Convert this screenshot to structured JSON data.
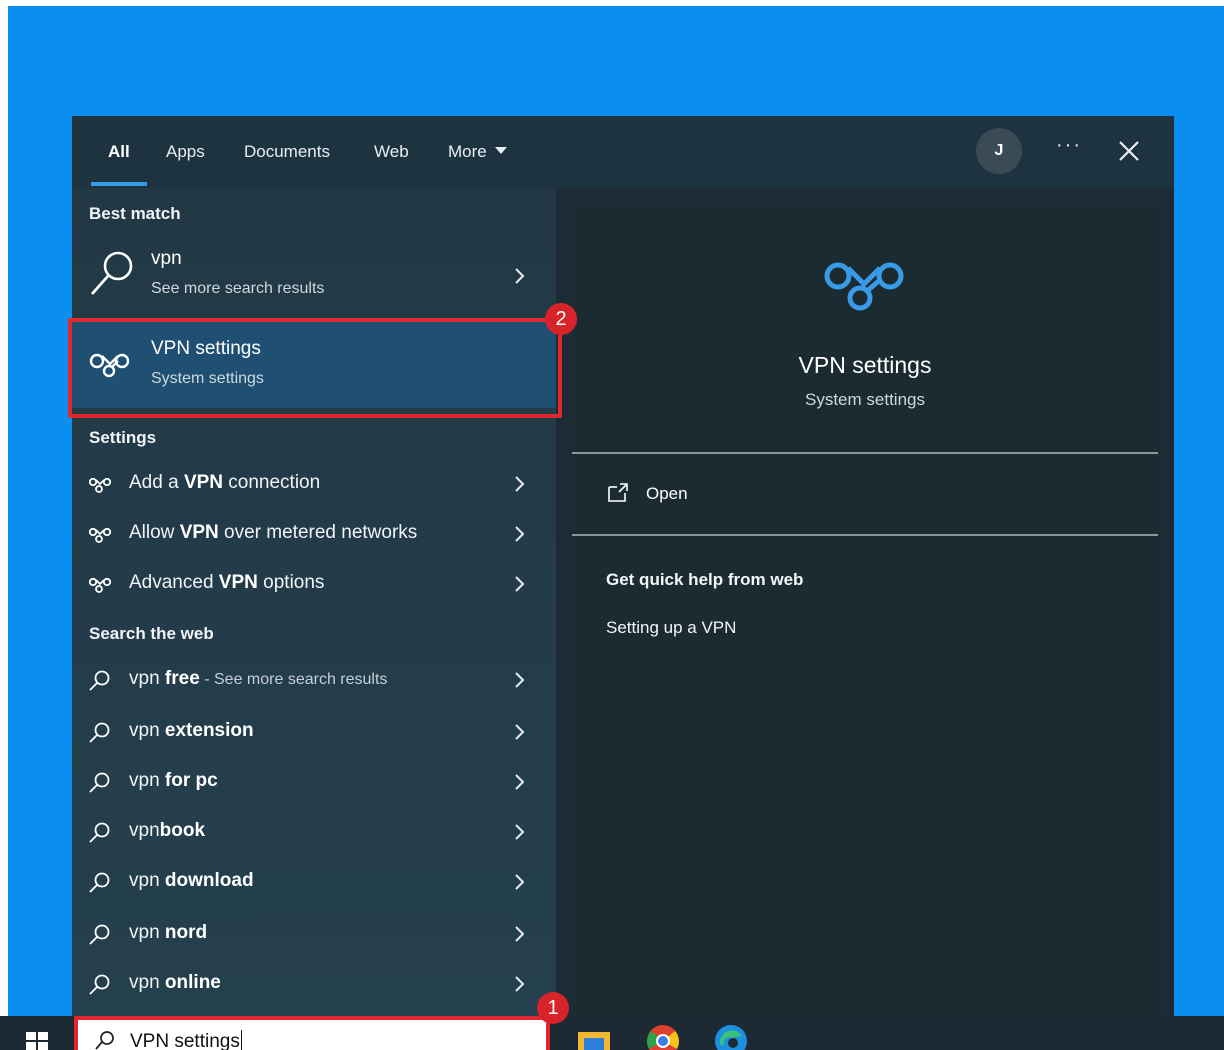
{
  "tabs": [
    {
      "label": "All",
      "active": true
    },
    {
      "label": "Apps"
    },
    {
      "label": "Documents"
    },
    {
      "label": "Web"
    },
    {
      "label": "More"
    }
  ],
  "header": {
    "avatar_initial": "J",
    "more_options": "···"
  },
  "best_match": {
    "heading": "Best match",
    "web_result": {
      "title": "vpn",
      "subtitle": "See more search results"
    },
    "selected_result": {
      "title": "VPN settings",
      "subtitle": "System settings"
    }
  },
  "settings": {
    "heading": "Settings",
    "items": [
      {
        "prefix": "Add a ",
        "bold": "VPN",
        "suffix": " connection"
      },
      {
        "prefix": "Allow ",
        "bold": "VPN",
        "suffix": " over metered networks"
      },
      {
        "prefix": "Advanced ",
        "bold": "VPN",
        "suffix": " options"
      }
    ]
  },
  "web": {
    "heading": "Search the web",
    "items": [
      {
        "prefix": "vpn ",
        "bold": "free",
        "muted": " - See more search results"
      },
      {
        "prefix": "vpn ",
        "bold": "extension"
      },
      {
        "prefix": "vpn ",
        "bold": "for pc"
      },
      {
        "prefix": "vpn",
        "bold": "book"
      },
      {
        "prefix": "vpn ",
        "bold": "download"
      },
      {
        "prefix": "vpn ",
        "bold": "nord"
      },
      {
        "prefix": "vpn ",
        "bold": "online"
      }
    ]
  },
  "preview": {
    "title": "VPN settings",
    "subtitle": "System settings",
    "open_label": "Open",
    "help_heading": "Get quick help from web",
    "help_link": "Setting up a VPN"
  },
  "search": {
    "value": "VPN settings"
  },
  "annotations": {
    "badge_1": "1",
    "badge_2": "2"
  },
  "colors": {
    "accent": "#3a9ae8",
    "highlight": "#e0282e",
    "selected_bg": "#1f4f72",
    "desktop": "#0a8ef0"
  }
}
